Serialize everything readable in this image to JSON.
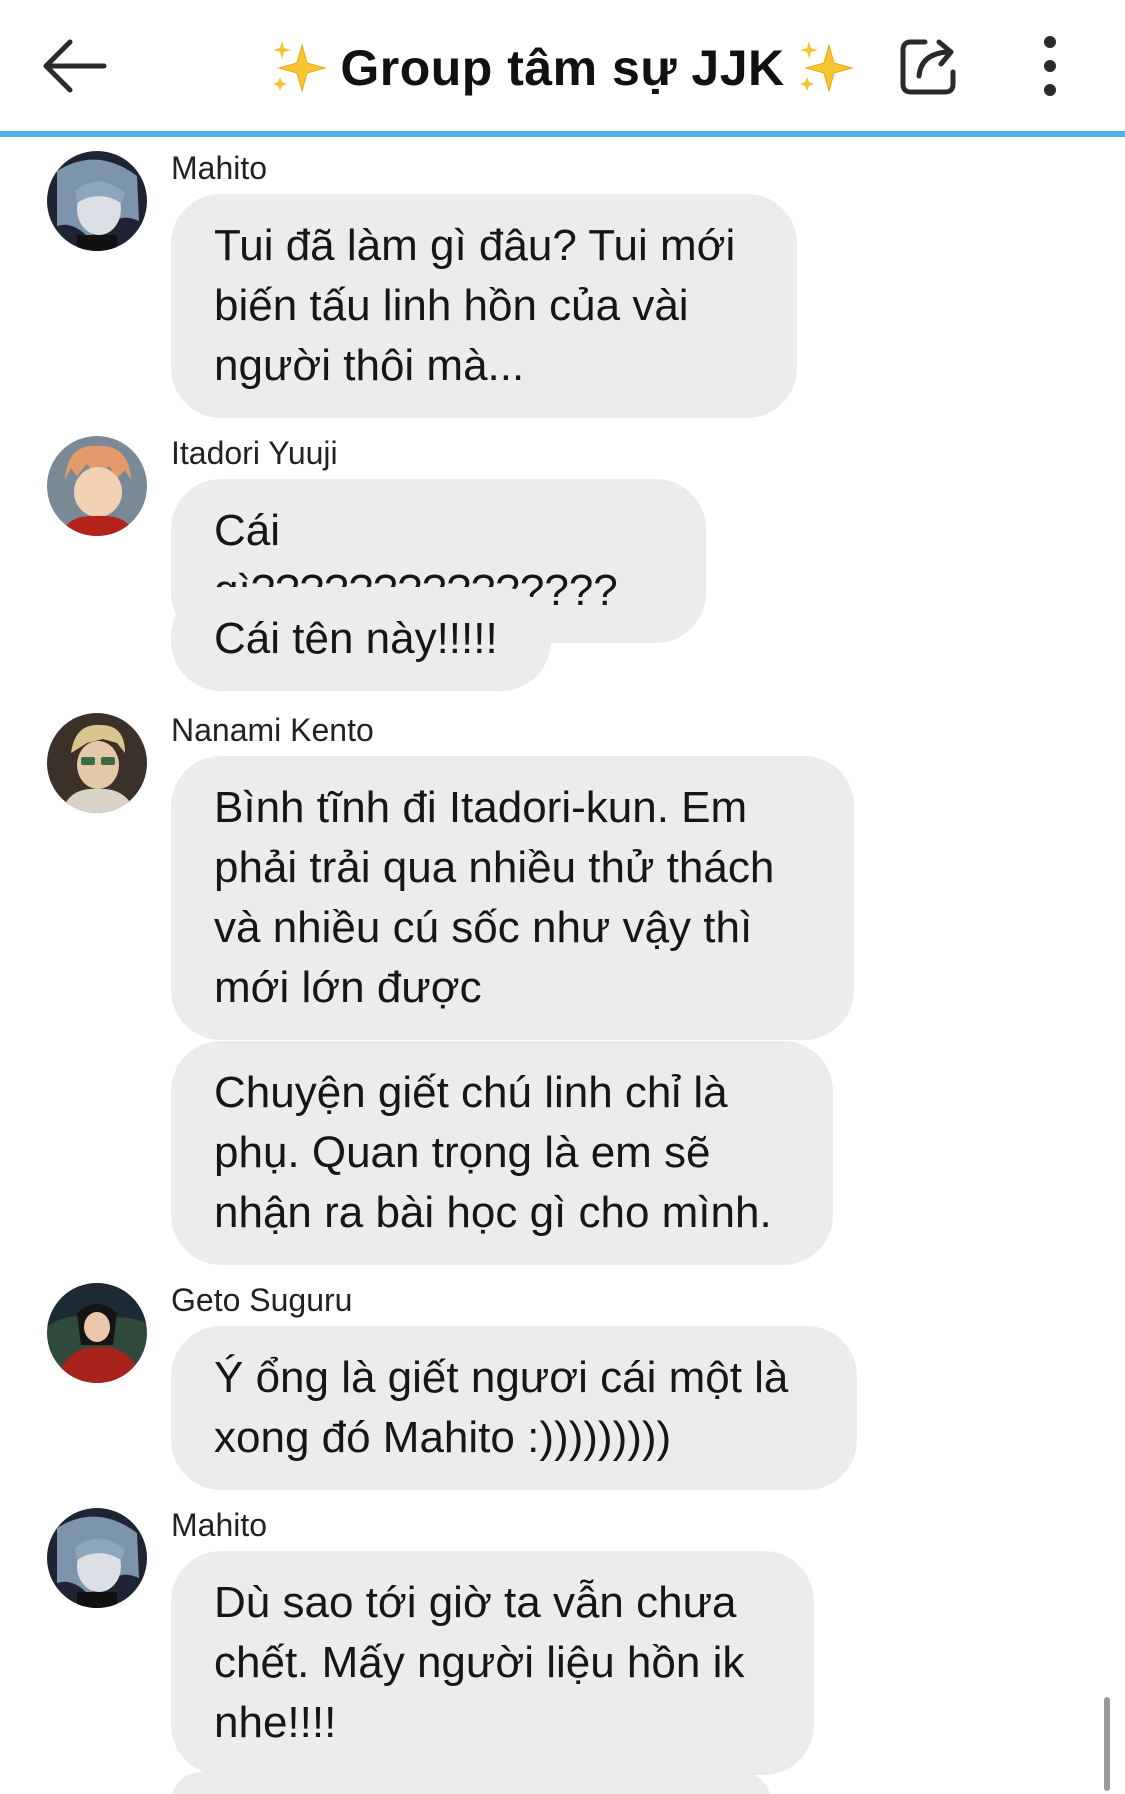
{
  "header": {
    "title": "Group tâm sự JJK",
    "back_icon": "arrow-left-icon",
    "sparkle_icon": "sparkles-icon",
    "share_icon": "share-icon",
    "more_icon": "more-vertical-icon",
    "accent_color": "#4fb3ec"
  },
  "messages": [
    {
      "sender": "Mahito",
      "avatar": "avatar-mahito",
      "bubbles": [
        "Tui đã làm gì đâu? Tui mới biến tấu linh hồn của vài người thôi mà..."
      ]
    },
    {
      "sender": "Itadori Yuuji",
      "avatar": "avatar-itadori",
      "bubbles": [
        "Cái gì???????????????",
        "Cái tên này!!!!!"
      ]
    },
    {
      "sender": "Nanami Kento",
      "avatar": "avatar-nanami",
      "bubbles": [
        "Bình tĩnh đi Itadori-kun. Em phải trải qua nhiều thử thách và nhiều cú sốc như vậy thì mới lớn được",
        "Chuyện giết chú linh chỉ là phụ. Quan trọng là em sẽ nhận ra bài học gì cho mình."
      ]
    },
    {
      "sender": "Geto Suguru",
      "avatar": "avatar-geto",
      "bubbles": [
        "Ý ổng là giết ngươi cái một là xong đó Mahito :)))))))))"
      ]
    },
    {
      "sender": "Mahito",
      "avatar": "avatar-mahito",
      "bubbles": [
        "Dù sao tới giờ ta vẫn chưa chết. Mấy người liệu hồn ik nhe!!!!"
      ]
    }
  ]
}
